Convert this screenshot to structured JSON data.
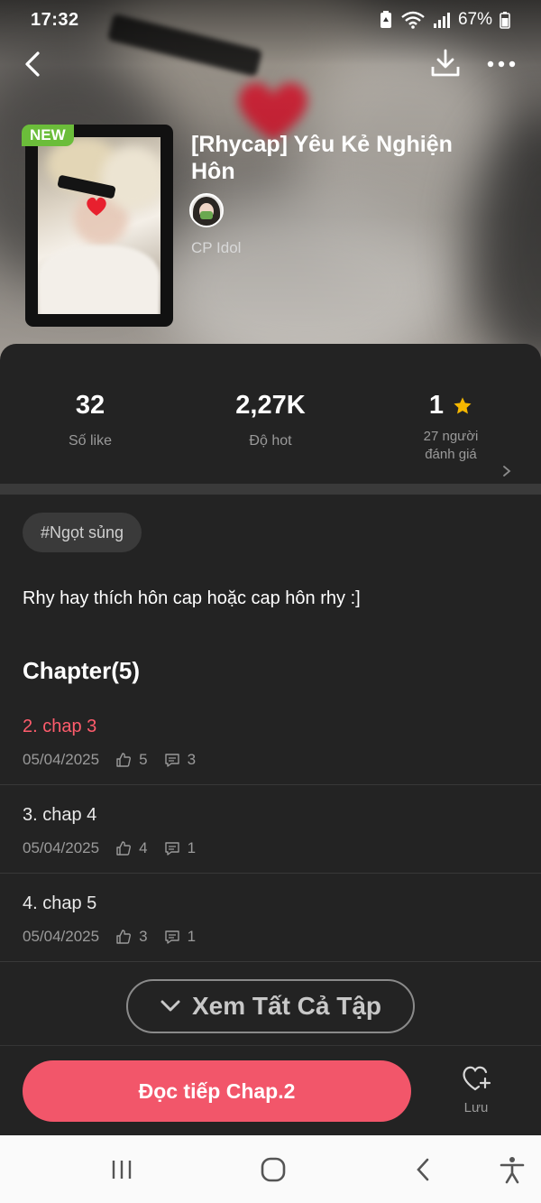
{
  "status_bar": {
    "time": "17:32",
    "battery": "67%"
  },
  "book": {
    "badge": "NEW",
    "title": "[Rhycap] Yêu Kẻ Nghiện Hôn",
    "author": "CP Idol"
  },
  "stats": [
    {
      "value": "32",
      "label": "Số like"
    },
    {
      "value": "2,27K",
      "label": "Độ hot"
    },
    {
      "value": "1",
      "label_line1": "27 người",
      "label_line2": "đánh giá"
    }
  ],
  "tag": "#Ngọt sủng",
  "description": "Rhy hay thích hôn cap hoặc cap hôn rhy :]",
  "chapters_heading": "Chapter(5)",
  "chapters": [
    {
      "name": "2. chap 3",
      "date": "05/04/2025",
      "likes": "5",
      "comments": "3",
      "active": true
    },
    {
      "name": "3. chap 4",
      "date": "05/04/2025",
      "likes": "4",
      "comments": "1",
      "active": false
    },
    {
      "name": "4. chap 5",
      "date": "05/04/2025",
      "likes": "3",
      "comments": "1",
      "active": false
    }
  ],
  "see_all_label": "Xem Tất Cả Tập",
  "read_button_label": "Đọc tiếp Chap.2",
  "save_label": "Lưu",
  "colors": {
    "accent": "#f2566a",
    "active_chapter": "#ff5c6c",
    "new_badge": "#6bbd3a",
    "star": "#f5b700"
  },
  "icons": [
    "back-arrow-icon",
    "download-icon",
    "more-dots-icon",
    "star-icon",
    "chevron-right-icon",
    "thumb-up-icon",
    "comment-icon",
    "chevron-down-icon",
    "heart-plus-icon",
    "recent-apps-icon",
    "home-icon",
    "nav-back-icon",
    "accessibility-icon"
  ]
}
